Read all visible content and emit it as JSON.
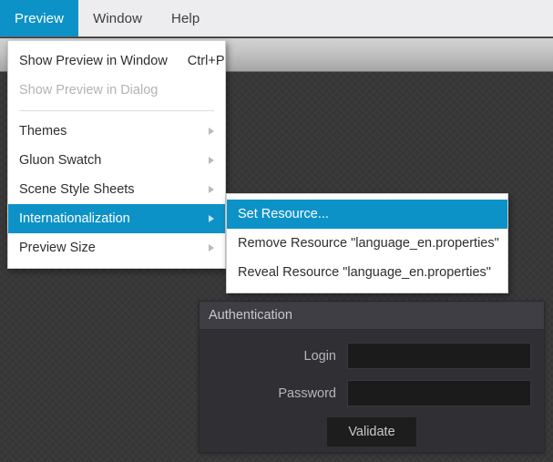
{
  "menubar": {
    "items": [
      {
        "label": "Preview",
        "active": true
      },
      {
        "label": "Window",
        "active": false
      },
      {
        "label": "Help",
        "active": false
      }
    ]
  },
  "preview_menu": {
    "items": [
      {
        "label": "Show Preview in Window",
        "accelerator": "Ctrl+P",
        "state": "enabled",
        "has_submenu": false
      },
      {
        "label": "Show Preview in Dialog",
        "accelerator": "",
        "state": "disabled",
        "has_submenu": false
      },
      {
        "label": "Themes",
        "accelerator": "",
        "state": "enabled",
        "has_submenu": true
      },
      {
        "label": "Gluon Swatch",
        "accelerator": "",
        "state": "enabled",
        "has_submenu": true
      },
      {
        "label": "Scene Style Sheets",
        "accelerator": "",
        "state": "enabled",
        "has_submenu": true
      },
      {
        "label": "Internationalization",
        "accelerator": "",
        "state": "highlighted",
        "has_submenu": true
      },
      {
        "label": "Preview Size",
        "accelerator": "",
        "state": "enabled",
        "has_submenu": true
      }
    ]
  },
  "i18n_submenu": {
    "items": [
      {
        "label": "Set Resource...",
        "state": "highlighted"
      },
      {
        "label": "Remove Resource \"language_en.properties\"",
        "state": "enabled"
      },
      {
        "label": "Reveal Resource \"language_en.properties\"",
        "state": "enabled"
      }
    ]
  },
  "auth_panel": {
    "title": "Authentication",
    "fields": [
      {
        "label": "Login",
        "value": "",
        "placeholder": ""
      },
      {
        "label": "Password",
        "value": "",
        "placeholder": ""
      }
    ],
    "submit_label": "Validate"
  },
  "colors": {
    "accent_blue": "#0d92c8",
    "menubar_bg": "#ededef",
    "menu_bg": "#ffffff",
    "panel_bg": "#303034",
    "panel_titlebar_bg": "#3e3e44",
    "input_bg": "#1b1b1b",
    "canvas_bg": "#3b3b3b"
  }
}
